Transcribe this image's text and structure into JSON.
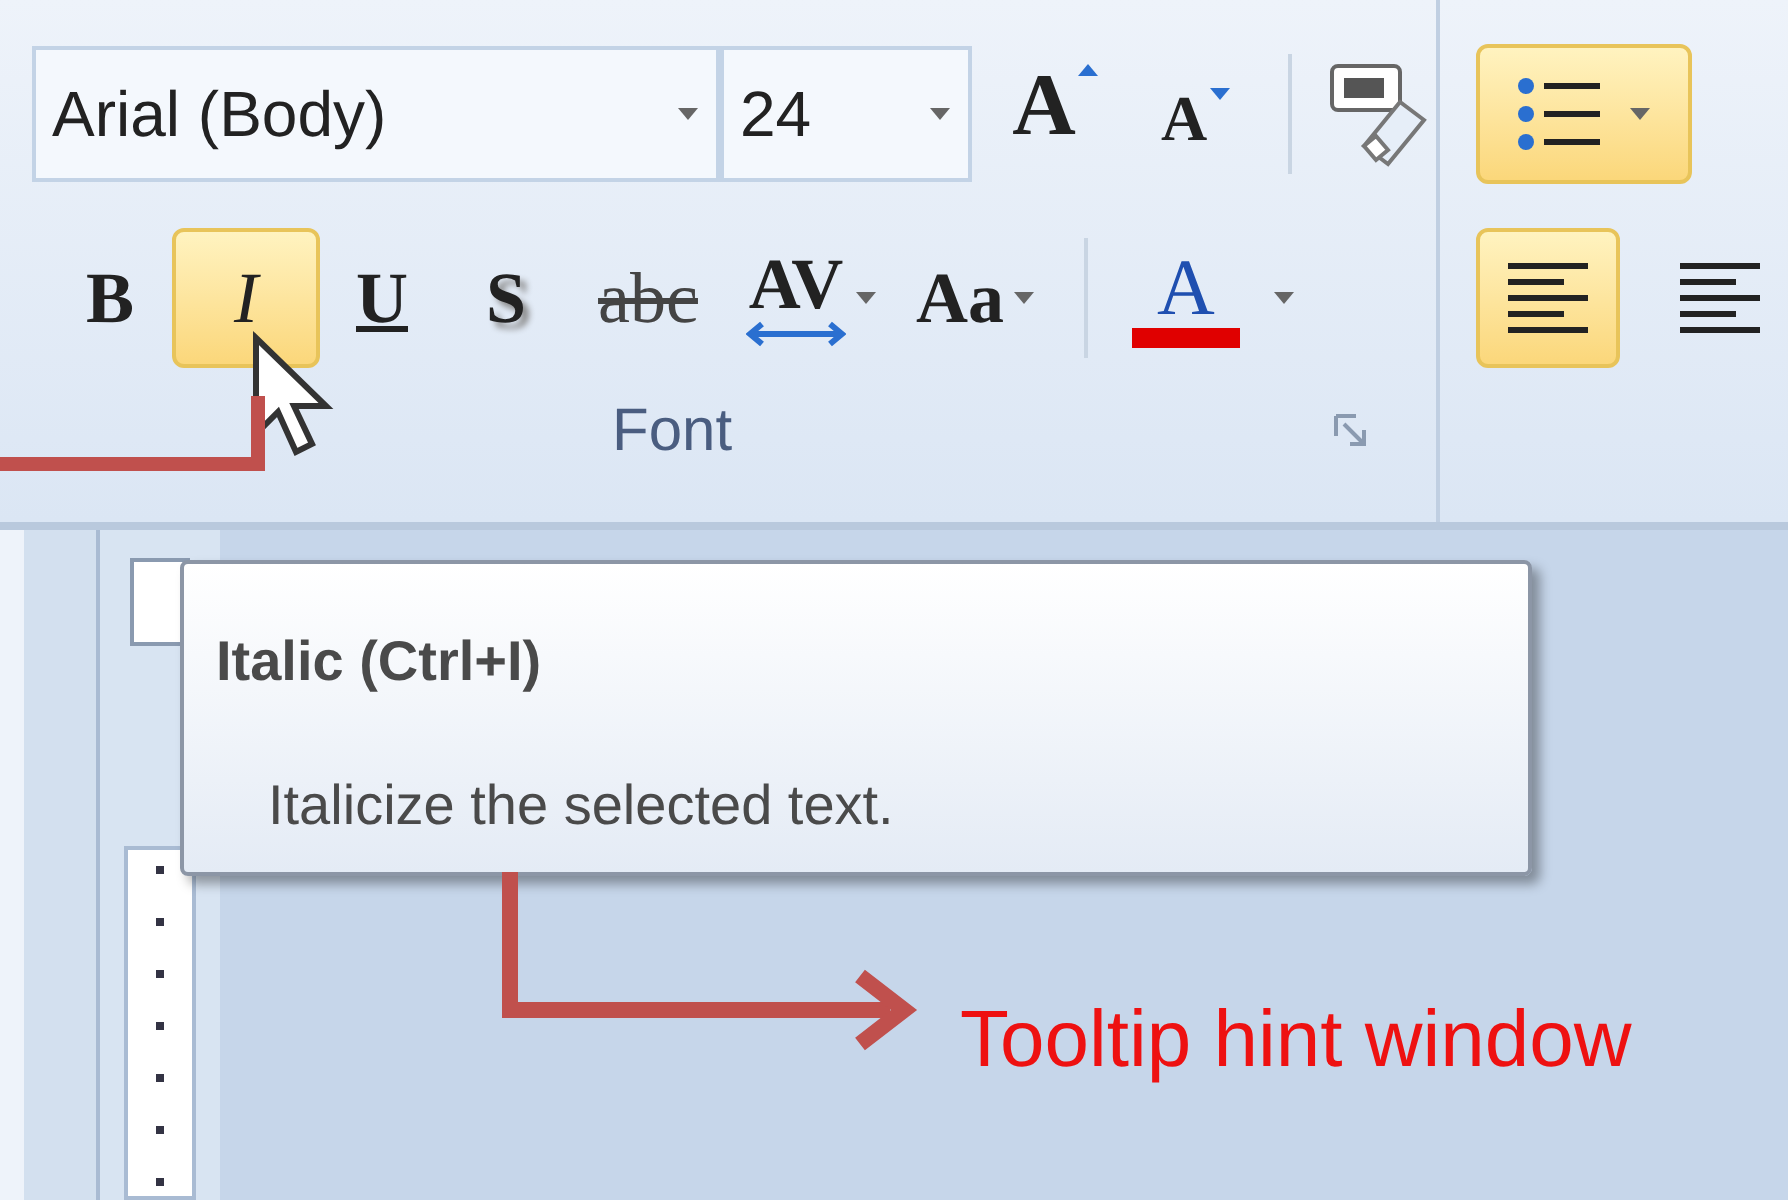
{
  "font_group": {
    "font_name": "Arial (Body)",
    "font_size": "24",
    "grow_label": "A",
    "shrink_label": "A",
    "format_buttons": [
      {
        "kind": "bold",
        "label": "B",
        "selected": false
      },
      {
        "kind": "italic",
        "label": "I",
        "selected": true
      },
      {
        "kind": "underline",
        "label": "U",
        "selected": false
      },
      {
        "kind": "shadow",
        "label": "S",
        "selected": false
      },
      {
        "kind": "strike",
        "label": "abc",
        "selected": false
      },
      {
        "kind": "spacing",
        "label": "AV",
        "selected": false
      },
      {
        "kind": "case",
        "label": "Aa",
        "selected": false
      }
    ],
    "font_color": {
      "label": "A",
      "color": "#e00000"
    },
    "label": "Font"
  },
  "paragraph_group": {
    "bullets": {
      "selected": true
    },
    "align_buttons": [
      {
        "selected": true
      },
      {
        "selected": false
      }
    ]
  },
  "tooltip": {
    "title": "Italic (Ctrl+I)",
    "description": "Italicize the selected text."
  },
  "annotation": {
    "label": "Tooltip hint window"
  }
}
